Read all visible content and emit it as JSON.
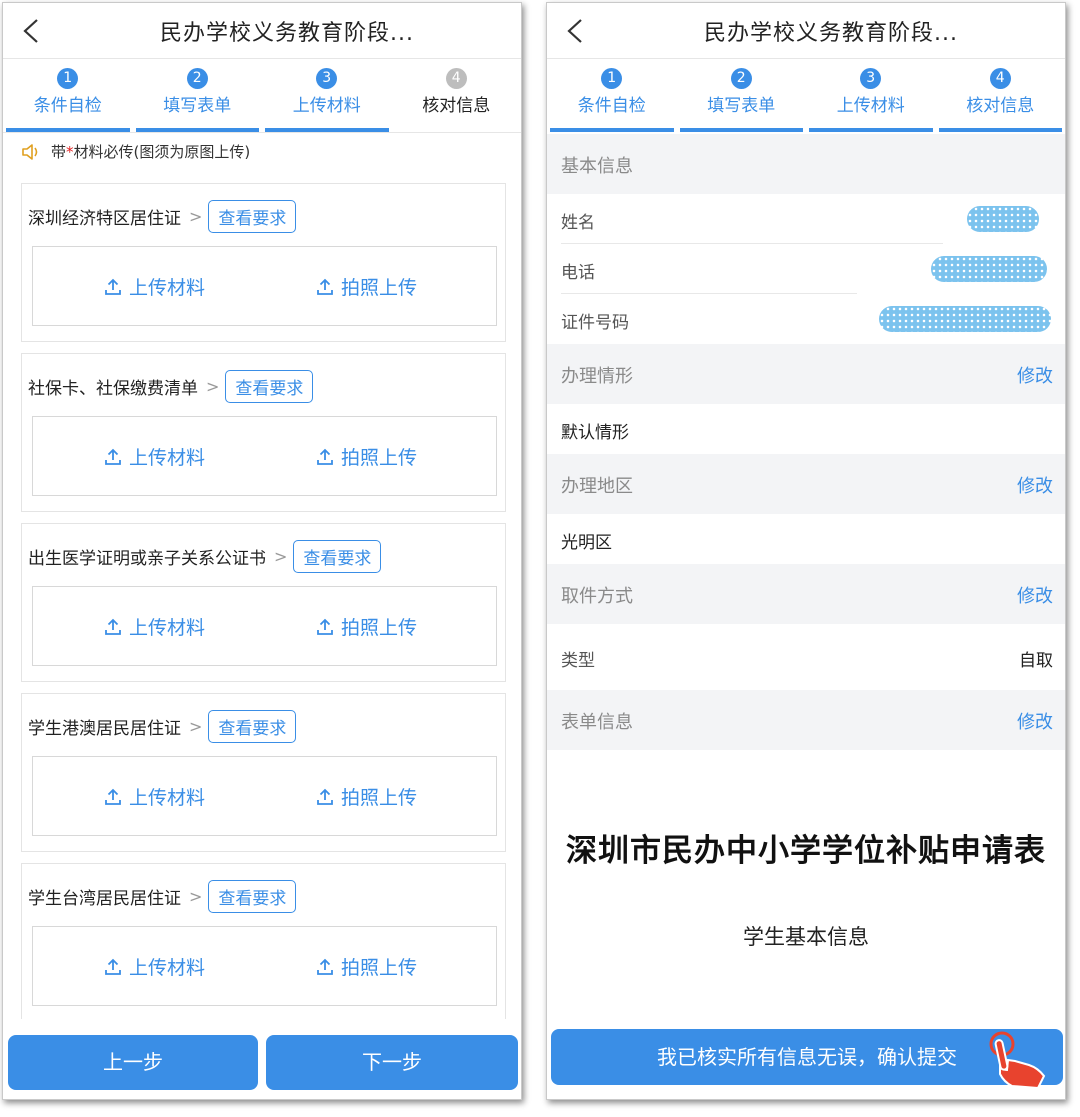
{
  "left": {
    "title": "民办学校义务教育阶段...",
    "steps": [
      {
        "num": "1",
        "label": "条件自检",
        "state": "done"
      },
      {
        "num": "2",
        "label": "填写表单",
        "state": "done"
      },
      {
        "num": "3",
        "label": "上传材料",
        "state": "active"
      },
      {
        "num": "4",
        "label": "核对信息",
        "state": "pending"
      }
    ],
    "notice": {
      "prefix": "带 ",
      "star": "*",
      "text": "材料必传(图须为原图上传)"
    },
    "materials": [
      {
        "name": "深圳经济特区居住证"
      },
      {
        "name": "社保卡、社保缴费清单"
      },
      {
        "name": "出生医学证明或亲子关系公证书"
      },
      {
        "name": "学生港澳居民居住证"
      },
      {
        "name": "学生台湾居民居住证"
      }
    ],
    "chevron": ">",
    "req_label": "查看要求",
    "upload_label": "上传材料",
    "photo_label": "拍照上传",
    "prev_label": "上一步",
    "next_label": "下一步"
  },
  "right": {
    "title": "民办学校义务教育阶段...",
    "steps": [
      {
        "num": "1",
        "label": "条件自检",
        "state": "done"
      },
      {
        "num": "2",
        "label": "填写表单",
        "state": "done"
      },
      {
        "num": "3",
        "label": "上传材料",
        "state": "done"
      },
      {
        "num": "4",
        "label": "核对信息",
        "state": "active"
      }
    ],
    "edit_label": "修改",
    "basic_info": {
      "label": "基本信息",
      "name_label": "姓名",
      "phone_label": "电话",
      "id_label": "证件号码"
    },
    "handle_case": {
      "label": "办理情形",
      "value": "默认情形"
    },
    "handle_area": {
      "label": "办理地区",
      "value": "光明区"
    },
    "pickup": {
      "label": "取件方式",
      "type_label": "类型",
      "type_value": "自取"
    },
    "form_info": {
      "label": "表单信息"
    },
    "form_title": "深圳市民办中小学学位补贴申请表",
    "form_subtitle": "学生基本信息",
    "confirm_label": "我已核实所有信息无误，确认提交"
  },
  "colors": {
    "accent": "#3a8ee6",
    "required": "#e02020",
    "pending": "#bdbdbd",
    "section_bg": "#f3f4f6"
  }
}
